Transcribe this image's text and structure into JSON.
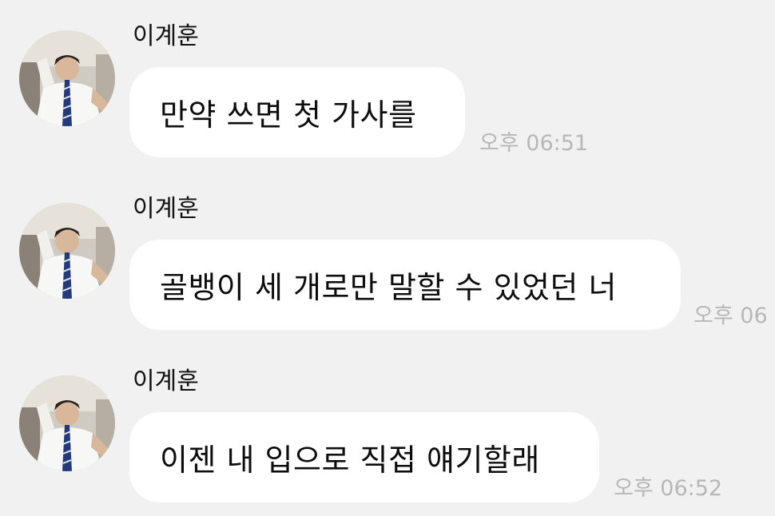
{
  "messages": [
    {
      "sender": "이계훈",
      "text": "만약 쓰면 첫 가사를",
      "time": "오후 06:51",
      "avatar": "profile-photo"
    },
    {
      "sender": "이계훈",
      "text": "골뱅이 세 개로만 말할 수 있었던 너",
      "time": "오후 06",
      "avatar": "profile-photo"
    },
    {
      "sender": "이계훈",
      "text": "이젠 내 입으로 직접 얘기할래",
      "time": "오후 06:52",
      "avatar": "profile-photo"
    }
  ],
  "colors": {
    "background": "#f1f1f1",
    "bubble": "#ffffff",
    "timestamp": "#b7b7b7",
    "text": "#0d0d0d"
  }
}
